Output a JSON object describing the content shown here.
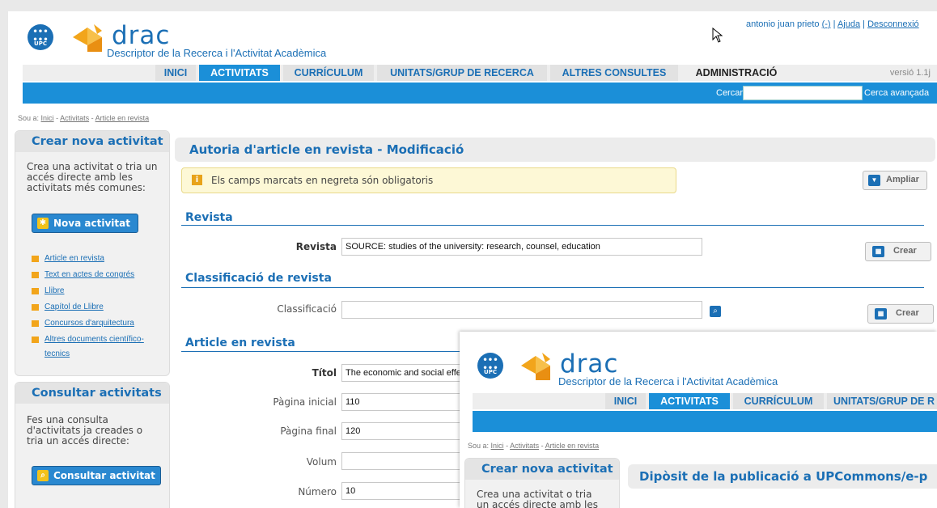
{
  "header": {
    "brand": "drac",
    "subtitle": "Descriptor de la Recerca i l'Activitat Acadèmica",
    "upc_logo_text": "UPC",
    "user_name": "antonio juan prieto",
    "user_paren": "(-)",
    "help_link": "Ajuda",
    "logout_link": "Desconnexió",
    "separator": "|"
  },
  "nav": {
    "tabs": [
      {
        "label": "INICI"
      },
      {
        "label": "ACTIVITATS"
      },
      {
        "label": "CURRÍCULUM"
      },
      {
        "label": "UNITATS/GRUP DE RECERCA"
      },
      {
        "label": "ALTRES CONSULTES"
      },
      {
        "label": "ADMINISTRACIÓ"
      }
    ],
    "version": "versió 1.1j"
  },
  "search": {
    "label": "Cercar",
    "value": "",
    "advanced": "Cerca avançada"
  },
  "breadcrumb": {
    "prefix": "Sou a:",
    "items": [
      "Inici",
      "Activitats",
      "Article en revista"
    ],
    "sep": "-"
  },
  "sidebar": {
    "create": {
      "title": "Crear nova activitat",
      "text": "Crea una activitat o tria un accés directe amb les activitats més comunes:",
      "button": "Nova activitat",
      "links": [
        "Article en revista",
        "Text en actes de congrés",
        "Llibre",
        "Capítol de Llibre",
        "Concursos d'arquitectura",
        "Altres documents científico-",
        "tecnics"
      ]
    },
    "consult": {
      "title": "Consultar activitats",
      "text": "Fes una consulta d'activitats ja creades o tria un accés directe:",
      "button": "Consultar activitat"
    }
  },
  "main": {
    "title": "Autoria d'article en revista - Modificació",
    "notice": "Els camps marcats en negreta són obligatoris",
    "expand_button": "Ampliar",
    "sections": {
      "revista": "Revista",
      "classificacio": "Classificació de revista",
      "article": "Article en revista"
    },
    "fields": {
      "revista_label": "Revista",
      "revista_value": "SOURCE: studies of the university: research, counsel, education",
      "classificacio_label": "Classificació",
      "classificacio_value": "",
      "titol_label": "Títol",
      "titol_value": "The economic and social effe",
      "pagina_inicial_label": "Pàgina inicial",
      "pagina_inicial_value": "110",
      "pagina_final_label": "Pàgina final",
      "pagina_final_value": "120",
      "volum_label": "Volum",
      "volum_value": "",
      "numero_label": "Número",
      "numero_value": "10"
    },
    "create_button": "Crear"
  },
  "overlay": {
    "brand": "drac",
    "subtitle": "Descriptor de la Recerca i l'Activitat Acadèmica",
    "upc_logo_text": "UPC",
    "tabs": [
      {
        "label": "INICI"
      },
      {
        "label": "ACTIVITATS"
      },
      {
        "label": "CURRÍCULUM"
      },
      {
        "label": "UNITATS/GRUP DE R"
      }
    ],
    "breadcrumb": {
      "prefix": "Sou a:",
      "items": [
        "Inici",
        "Activitats",
        "Article en revista"
      ],
      "sep": "-"
    },
    "sidebar_title": "Crear nova activitat",
    "sidebar_text": "Crea una activitat o tria un accés directe amb les",
    "main_title": "Dipòsit de la publicació a UPCommons/e-p"
  },
  "colors": {
    "brand_blue": "#1b6fb5",
    "tab_active": "#1b8fd8",
    "accent_orange": "#f2a51b"
  }
}
